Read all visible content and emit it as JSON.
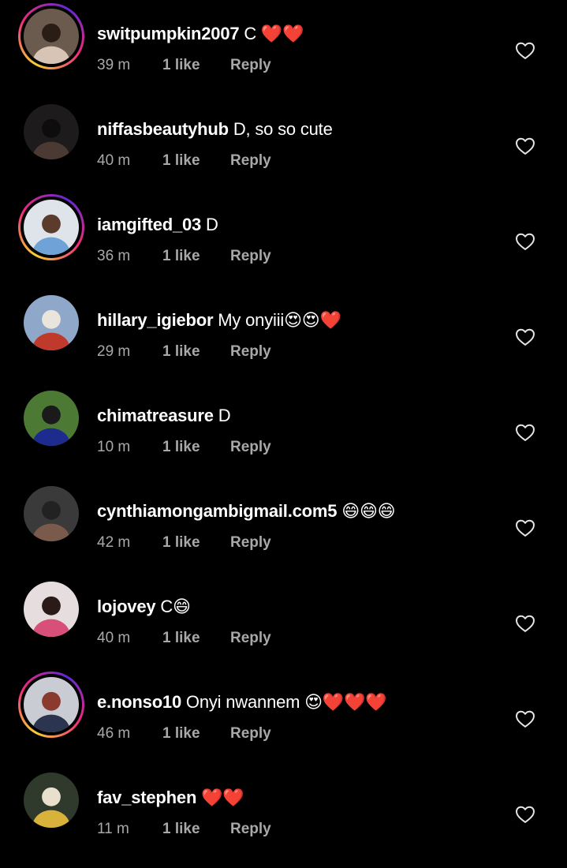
{
  "comments": [
    {
      "username": "switpumpkin2007",
      "text": " C ❤️❤️",
      "time": "39 m",
      "likes": "1 like",
      "reply": "Reply",
      "story_ring": true,
      "avatar_colors": [
        "#6b5a4e",
        "#d7c4b5",
        "#2a1d16"
      ]
    },
    {
      "username": "niffasbeautyhub",
      "text": " D,  so so cute",
      "time": "40 m",
      "likes": "1 like",
      "reply": "Reply",
      "story_ring": false,
      "avatar_colors": [
        "#1d1b1c",
        "#4a3a33",
        "#0d0d0d"
      ]
    },
    {
      "username": "iamgifted_03",
      "text": " D",
      "time": "36 m",
      "likes": "1 like",
      "reply": "Reply",
      "story_ring": true,
      "avatar_colors": [
        "#dfe3ea",
        "#6fa3d8",
        "#5b3b2b"
      ]
    },
    {
      "username": "hillary_igiebor",
      "text": " My onyiii😍😍❤️",
      "time": "29 m",
      "likes": "1 like",
      "reply": "Reply",
      "story_ring": false,
      "avatar_colors": [
        "#8fa7c9",
        "#c03a2b",
        "#e9e4dc"
      ]
    },
    {
      "username": "chimatreasure",
      "text": " D",
      "time": "10 m",
      "likes": "1 like",
      "reply": "Reply",
      "story_ring": false,
      "avatar_colors": [
        "#4c7a34",
        "#1d2b8f",
        "#1a1a1a"
      ]
    },
    {
      "username": "cynthiamongambigmail.com5",
      "text": " 😄😄😄",
      "time": "42 m",
      "likes": "1 like",
      "reply": "Reply",
      "story_ring": false,
      "avatar_colors": [
        "#3a3a3a",
        "#7a5a4a",
        "#222222"
      ]
    },
    {
      "username": "lojovey",
      "text": " C😄",
      "time": "40 m",
      "likes": "1 like",
      "reply": "Reply",
      "story_ring": false,
      "avatar_colors": [
        "#e6dede",
        "#d8507a",
        "#2a1a18"
      ]
    },
    {
      "username": "e.nonso10",
      "text": " Onyi nwannem 😍❤️❤️❤️",
      "time": "46 m",
      "likes": "1 like",
      "reply": "Reply",
      "story_ring": true,
      "avatar_colors": [
        "#c9ccd3",
        "#2c3550",
        "#8a3a2f"
      ]
    },
    {
      "username": "fav_stephen",
      "text": " ❤️❤️",
      "time": "11 m",
      "likes": "1 like",
      "reply": "Reply",
      "story_ring": false,
      "avatar_colors": [
        "#2f3a2c",
        "#d8b23a",
        "#e8e0cc"
      ]
    }
  ],
  "icons": {
    "like": "heart-outline-icon"
  },
  "colors": {
    "background": "#000000",
    "primary_text": "#ffffff",
    "secondary_text": "#a8a8a8"
  }
}
